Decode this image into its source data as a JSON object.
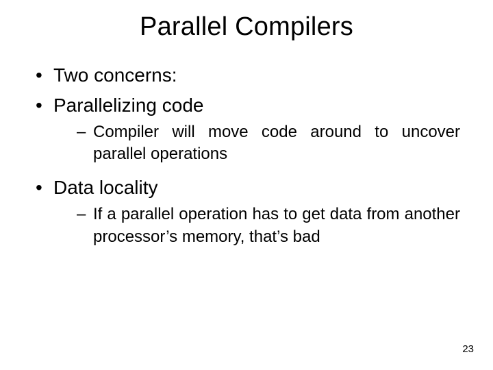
{
  "title": "Parallel Compilers",
  "bullets": {
    "b1": "Two concerns:",
    "b2": "Parallelizing code",
    "b2_sub": "Compiler will move code around to uncover parallel operations",
    "b3": "Data locality",
    "b3_sub": "If a parallel operation has to get data from another processor’s memory, that’s bad"
  },
  "page_number": "23"
}
